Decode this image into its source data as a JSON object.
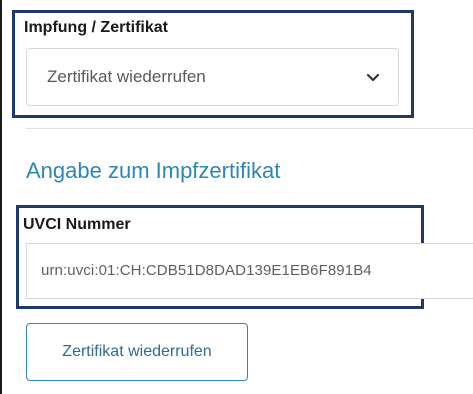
{
  "form": {
    "vaccination_label": "Impfung / Zertifikat",
    "action_select": {
      "selected": "Zertifikat wiederrufen",
      "icon": "chevron-down-icon"
    },
    "section_title": "Angabe zum Impfzertifikat",
    "uvci_label": "UVCI Nummer",
    "uvci_value": "urn:uvci:01:CH:CDB51D8DAD139E1EB6F891B4",
    "submit_label": "Zertifikat wiederrufen"
  },
  "colors": {
    "accent": "#2d87b4",
    "highlight_border": "#1f3a66",
    "field_border": "#d6d9dc"
  }
}
